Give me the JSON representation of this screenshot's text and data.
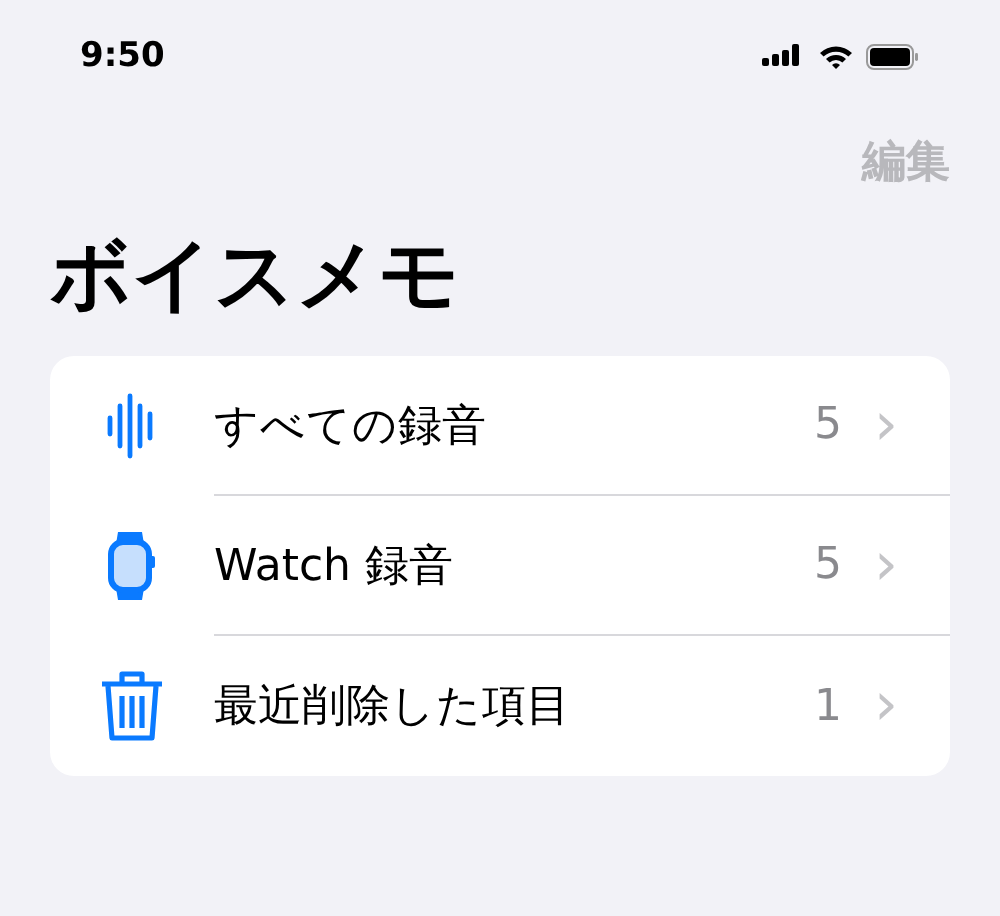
{
  "status_bar": {
    "time": "9:50"
  },
  "nav": {
    "edit": {
      "label": "編集",
      "disabled": true
    }
  },
  "title": "ボイスメモ",
  "folders": [
    {
      "kind": "waveform",
      "label": "すべての録音",
      "count": "5",
      "chevron": "›"
    },
    {
      "kind": "watch",
      "label": "Watch 録音",
      "count": "5",
      "chevron": "›"
    },
    {
      "kind": "trash",
      "label": "最近削除した項目",
      "count": "1",
      "chevron": "›"
    }
  ]
}
